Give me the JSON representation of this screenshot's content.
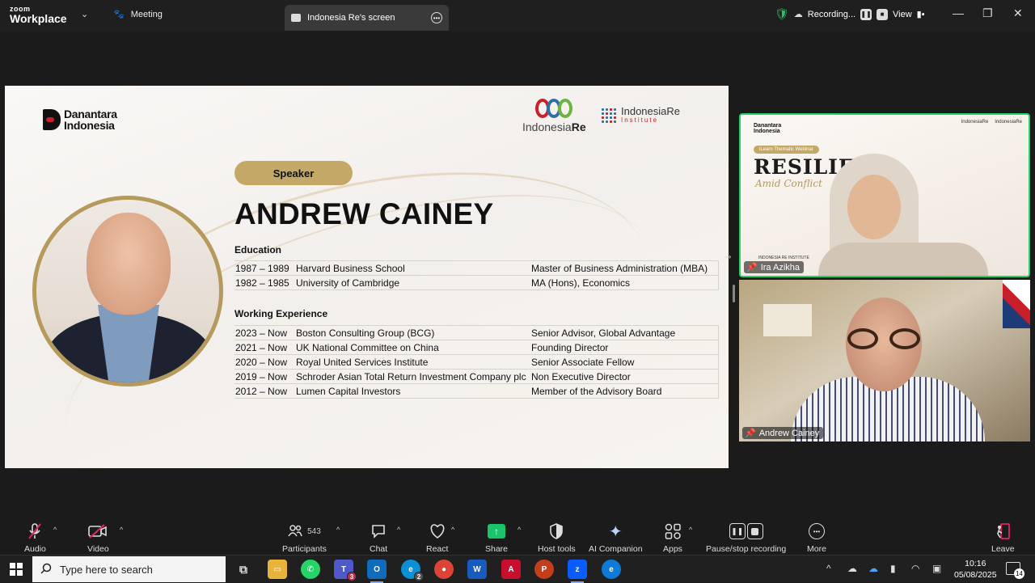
{
  "titlebar": {
    "brand_line1": "zoom",
    "brand_line2": "Workplace",
    "meeting_label": "Meeting",
    "active_tab": "Indonesia Re's screen",
    "recording_label": "Recording...",
    "view_label": "View"
  },
  "slide": {
    "logo_left": "Danantara Indonesia",
    "logo_left_l1": "Danantara",
    "logo_left_l2": "Indonesia",
    "logo_ir": "IndonesiaRe",
    "logo_ir_a": "Indonesia",
    "logo_ir_b": "Re",
    "logo_iri_1": "IndonesiaRe",
    "logo_iri_2": "Institute",
    "pill": "Speaker",
    "name": "ANDREW CAINEY",
    "education_heading": "Education",
    "education": [
      {
        "years": "1987 – 1989",
        "institution": "Harvard Business School",
        "degree": "Master of Business Administration (MBA)"
      },
      {
        "years": "1982 – 1985",
        "institution": "University of Cambridge",
        "degree": "MA (Hons), Economics"
      }
    ],
    "work_heading": "Working Experience",
    "work": [
      {
        "years": "2023 – Now",
        "org": "Boston Consulting Group (BCG)",
        "role": "Senior Advisor, Global Advantage"
      },
      {
        "years": "2021 – Now",
        "org": "UK National Committee on China",
        "role": "Founding Director"
      },
      {
        "years": "2020 – Now",
        "org": "Royal United Services Institute",
        "role": "Senior Associate Fellow"
      },
      {
        "years": "2019 – Now",
        "org": "Schroder Asian Total Return Investment Company plc",
        "role": "Non Executive Director"
      },
      {
        "years": "2012 – Now",
        "org": "Lumen Capital Investors",
        "role": "Member of the Advisory Board"
      }
    ]
  },
  "videos": {
    "v1": {
      "name": "Ira Azikha",
      "bg_logo_left": "Danantara Indonesia",
      "bg_logo_left_l1": "Danantara",
      "bg_logo_left_l2": "Indonesia",
      "bg_logo_right_1": "IndonesiaRe",
      "bg_logo_right_2": "IndonesiaRe",
      "bg_pill": "iLearn Thematic Webinar",
      "bg_title": "RESILIEN",
      "bg_sub": "Amid Conflict",
      "bg_footer": "INDONESIA RE INSTITUTE"
    },
    "v2": {
      "name": "Andrew Cainey"
    }
  },
  "toolbar": {
    "audio": "Audio",
    "video": "Video",
    "participants": "Participants",
    "participants_count": "543",
    "chat": "Chat",
    "react": "React",
    "share": "Share",
    "host_tools": "Host tools",
    "ai_companion": "AI Companion",
    "apps": "Apps",
    "pause_stop": "Pause/stop recording",
    "more": "More",
    "leave": "Leave"
  },
  "taskbar": {
    "search_placeholder": "Type here to search",
    "teams_badge": "3",
    "edge_badge": "2",
    "time": "10:16",
    "date": "05/08/2025",
    "notifications": "14"
  },
  "colors": {
    "accent_green": "#22d36a",
    "gold": "#c4a868",
    "share_green": "#19c46b"
  }
}
